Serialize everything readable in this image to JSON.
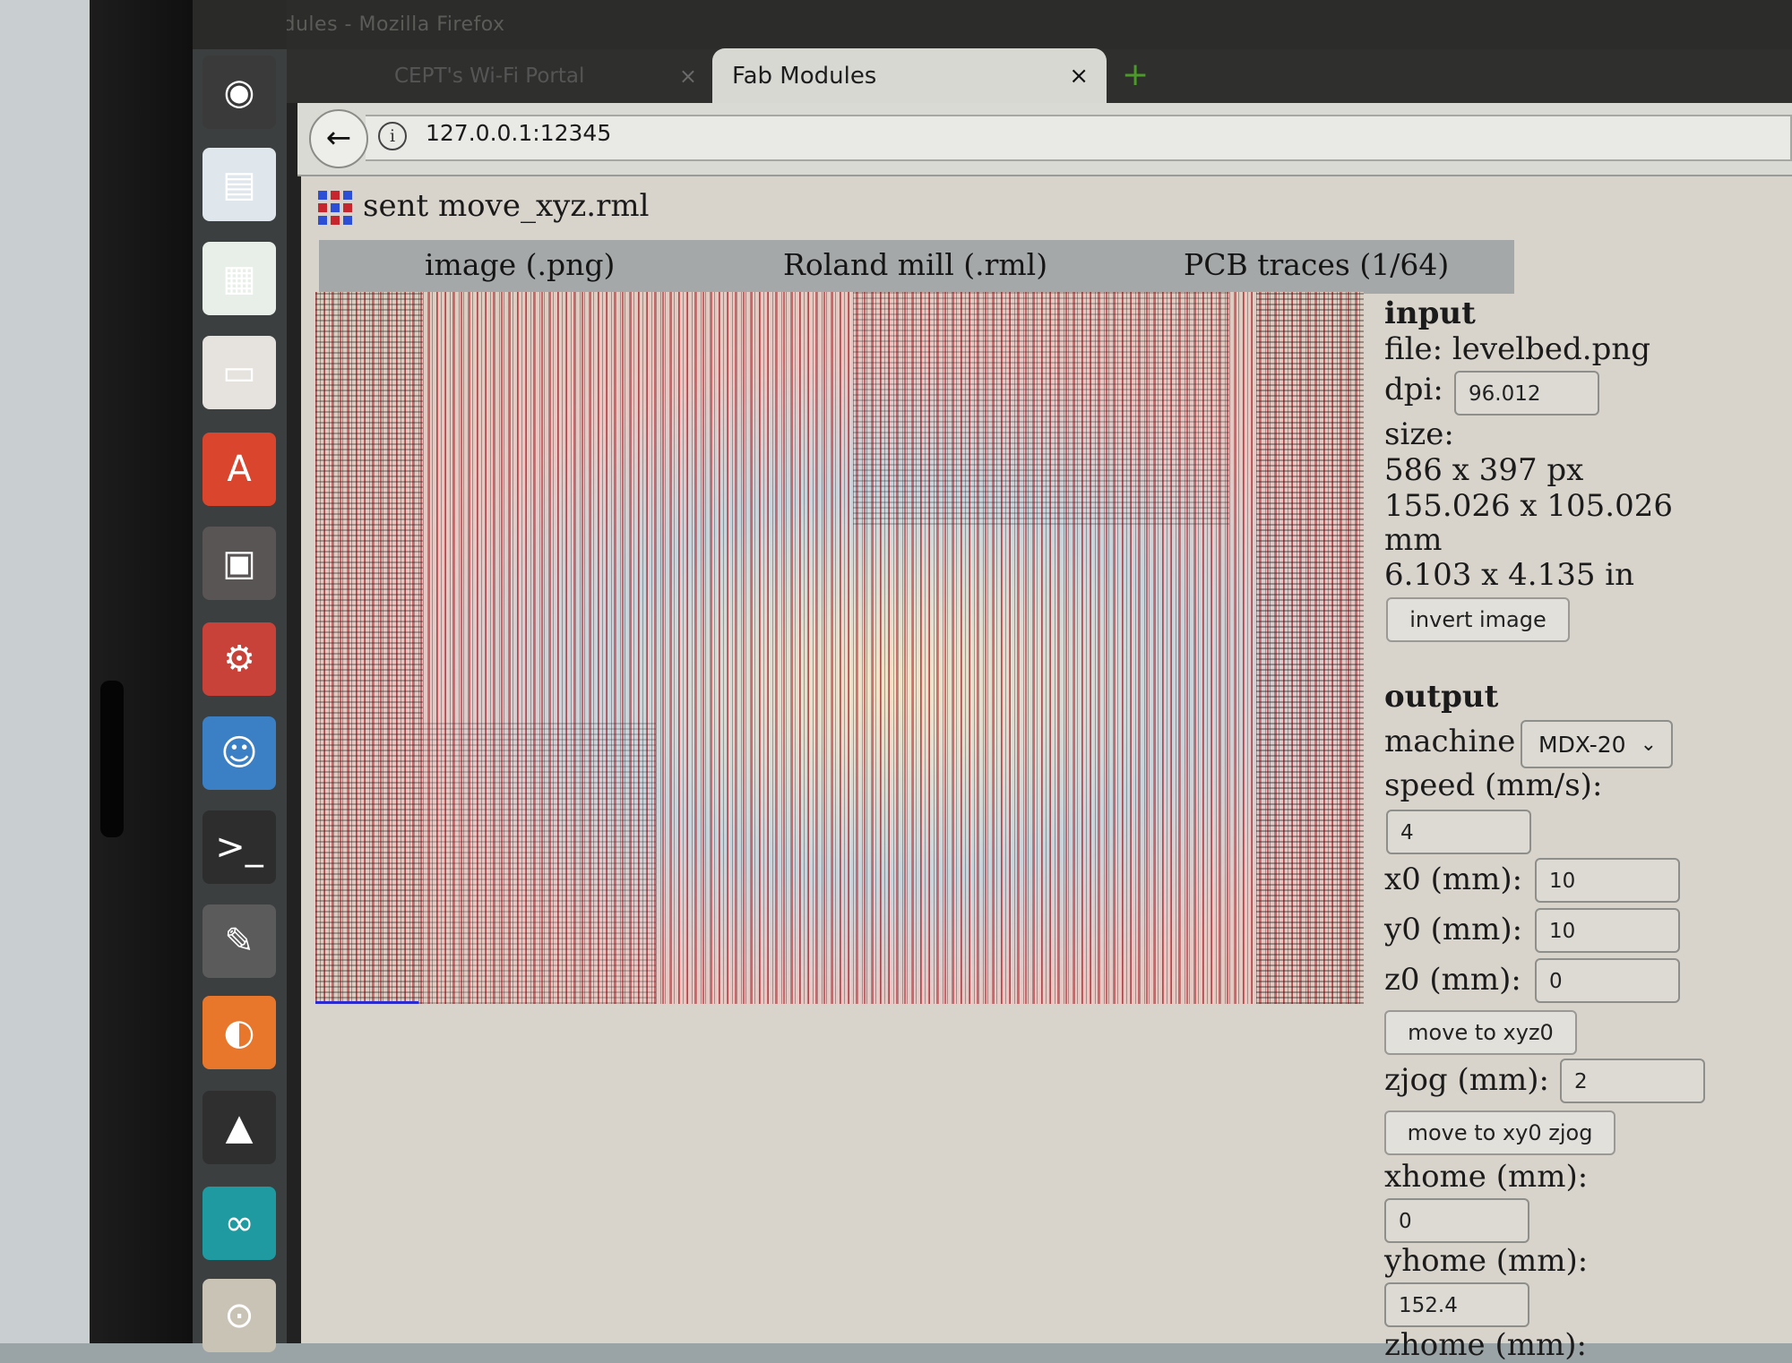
{
  "window": {
    "title": "Fab Modules - Mozilla Firefox"
  },
  "tabs": [
    {
      "label": "CEPT's Wi-Fi Portal",
      "active": false
    },
    {
      "label": "Fab Modules",
      "active": true
    }
  ],
  "tab_close_symbol": "×",
  "new_tab_symbol": "+",
  "url": "127.0.0.1:12345",
  "launcher": [
    {
      "icon": "ubuntu-logo-icon",
      "glyph": "◉",
      "color": "#3a3a3a"
    },
    {
      "icon": "document-writer-icon",
      "glyph": "▤",
      "color": "#dfe6ec"
    },
    {
      "icon": "spreadsheet-icon",
      "glyph": "▦",
      "color": "#e8efe8"
    },
    {
      "icon": "presentation-icon",
      "glyph": "▭",
      "color": "#e6e2de"
    },
    {
      "icon": "software-center-icon",
      "glyph": "A",
      "color": "#d9452d"
    },
    {
      "icon": "archive-manager-icon",
      "glyph": "▣",
      "color": "#5a5555"
    },
    {
      "icon": "system-settings-icon",
      "glyph": "⚙",
      "color": "#c8423a"
    },
    {
      "icon": "pidgin-chat-icon",
      "glyph": "☺",
      "color": "#3b7fc4"
    },
    {
      "icon": "terminal-icon",
      "glyph": ">_",
      "color": "#2d2d2d"
    },
    {
      "icon": "gimp-icon",
      "glyph": "✎",
      "color": "#5b5b5b"
    },
    {
      "icon": "firefox-icon",
      "glyph": "◐",
      "color": "#e8772c"
    },
    {
      "icon": "inkscape-icon",
      "glyph": "▲",
      "color": "#2f2f2f"
    },
    {
      "icon": "arduino-icon",
      "glyph": "∞",
      "color": "#1e9aa0"
    },
    {
      "icon": "magnifier-icon",
      "glyph": "⊙",
      "color": "#c9c3b5"
    }
  ],
  "app": {
    "status": "sent move_xyz.rml",
    "menu": {
      "input_format": "image (.png)",
      "output_format": "Roland mill (.rml)",
      "process": "PCB traces (1/64)"
    }
  },
  "input": {
    "heading": "input",
    "file": "file: levelbed.png",
    "dpi_label": "dpi:",
    "dpi_value": "96.012",
    "size_label": "size:",
    "size_px": "586 x 397 px",
    "size_mm": "155.026 x 105.026",
    "size_mm_unit": "mm",
    "size_in": "6.103 x 4.135 in",
    "invert_button": "invert image"
  },
  "output": {
    "heading": "output",
    "machine_label": "machine",
    "machine_value": "MDX-20",
    "speed_label": "speed (mm/s):",
    "speed_value": "4",
    "x0_label": "x0 (mm):",
    "x0_value": "10",
    "y0_label": "y0 (mm):",
    "y0_value": "10",
    "z0_label": "z0 (mm):",
    "z0_value": "0",
    "move_xyz0_button": "move to xyz0",
    "zjog_label": "zjog (mm):",
    "zjog_value": "2",
    "move_xy0_zjog_button": "move to xy0 zjog",
    "xhome_label": "xhome (mm):",
    "xhome_value": "0",
    "yhome_label": "yhome (mm):",
    "yhome_value": "152.4",
    "zhome_label": "zhome (mm):"
  },
  "colors": {
    "launcher_bg": "#3b3f40",
    "page_bg": "#d8d4cc",
    "menubar_bg": "#a5a8a9",
    "toolpath_red": "#b4141e"
  }
}
